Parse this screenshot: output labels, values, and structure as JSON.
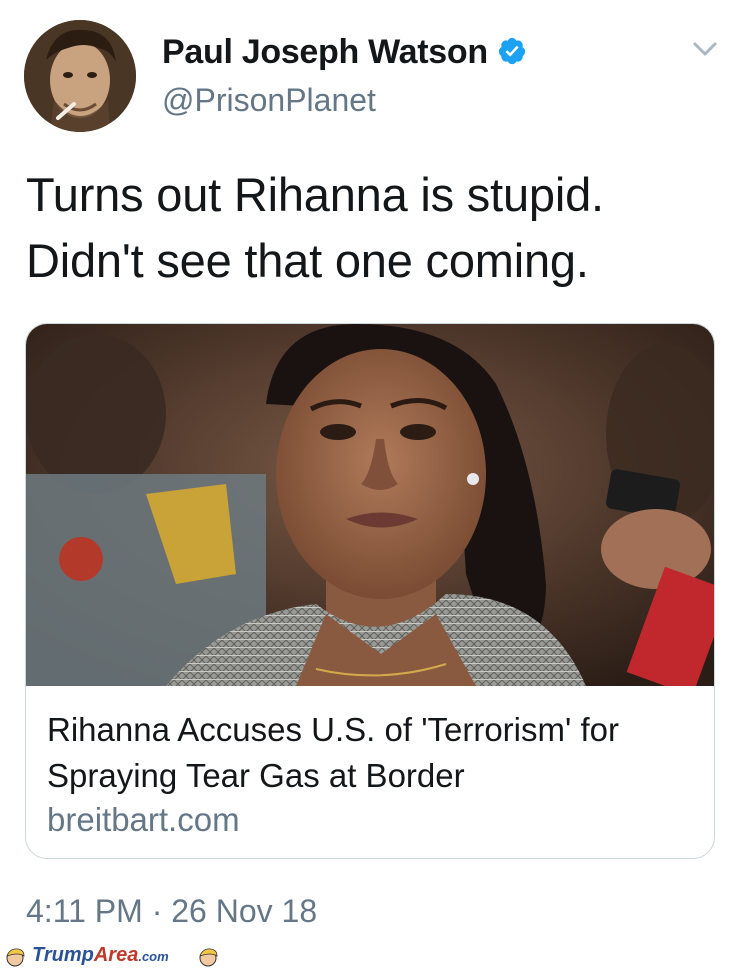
{
  "tweet": {
    "display_name": "Paul Joseph Watson",
    "handle": "@PrisonPlanet",
    "verified": true,
    "text_lines": [
      "Turns out Rihanna is stupid.",
      "Didn't see that one coming."
    ],
    "timestamp": "4:11 PM · 26 Nov 18"
  },
  "card": {
    "title_lines": [
      "Rihanna Accuses U.S. of 'Terrorism' for",
      "Spraying Tear Gas at Border"
    ],
    "domain": "breitbart.com"
  },
  "watermark": {
    "part1": "Trump",
    "part2": "Area",
    "part3": ".com"
  },
  "colors": {
    "text_primary": "#14171a",
    "text_secondary": "#657786",
    "verified_blue": "#1da1f2",
    "card_border": "#ccd6dd"
  },
  "icons": {
    "verified": "verified-badge-icon",
    "menu": "chevron-down-icon"
  }
}
